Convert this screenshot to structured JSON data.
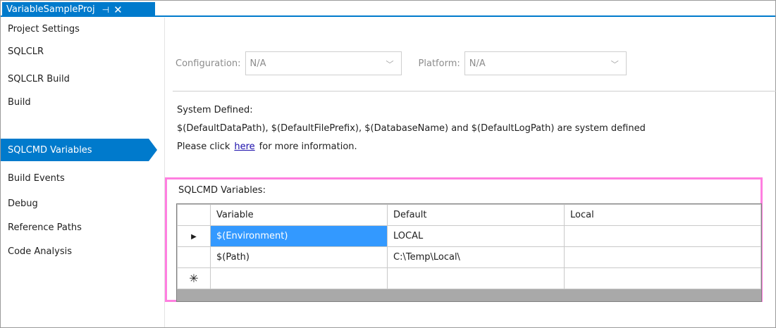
{
  "tab": {
    "title": "VariableSampleProj",
    "pin_icon": "pin-icon",
    "close_icon": "close-icon"
  },
  "sidebar": {
    "items": [
      {
        "label": "Project Settings"
      },
      {
        "label": "SQLCLR"
      },
      {
        "label": "SQLCLR Build"
      },
      {
        "label": "Build"
      },
      {
        "label": "SQLCMD Variables",
        "active": true
      },
      {
        "label": "Build Events"
      },
      {
        "label": "Debug"
      },
      {
        "label": "Reference Paths"
      },
      {
        "label": "Code Analysis"
      }
    ]
  },
  "config": {
    "configuration_label": "Configuration:",
    "configuration_value": "N/A",
    "platform_label": "Platform:",
    "platform_value": "N/A"
  },
  "system": {
    "title": "System Defined:",
    "description": "$(DefaultDataPath), $(DefaultFilePrefix), $(DatabaseName) and $(DefaultLogPath) are system defined",
    "info_prefix": "Please click",
    "info_link": "here",
    "info_suffix": "for more information."
  },
  "variables": {
    "title": "SQLCMD Variables:",
    "columns": [
      "Variable",
      "Default",
      "Local"
    ],
    "rows": [
      {
        "marker": "▶",
        "variable": "$(Environment)",
        "default": "LOCAL",
        "local": ""
      },
      {
        "marker": "",
        "variable": "$(Path)",
        "default": "C:\\Temp\\Local\\",
        "local": ""
      },
      {
        "marker": "✳",
        "variable": "",
        "default": "",
        "local": ""
      }
    ]
  },
  "colors": {
    "accent": "#007acc",
    "highlight": "#ff7fe0",
    "selection": "#3399ff"
  }
}
